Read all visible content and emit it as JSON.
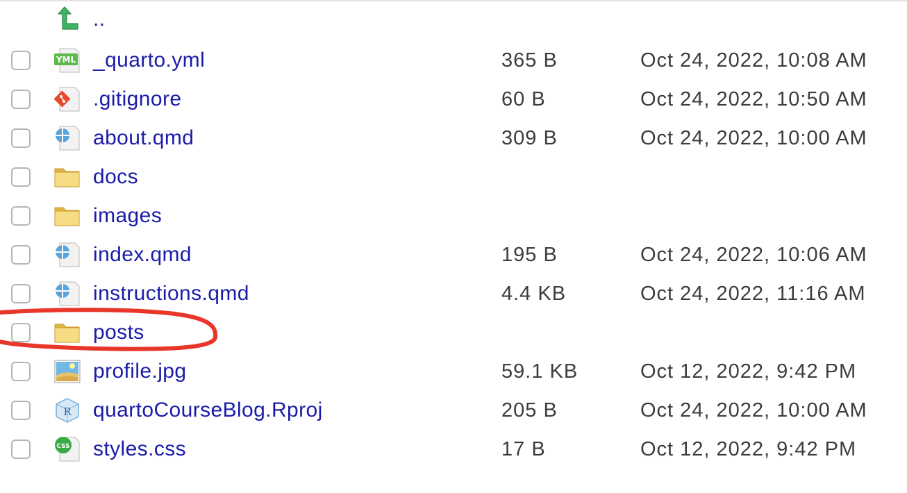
{
  "parent": {
    "label": "..",
    "icon": "up-arrow-icon"
  },
  "files": [
    {
      "name": "_quarto.yml",
      "size": "365 B",
      "modified": "Oct 24, 2022, 10:08 AM",
      "icon": "yml-file-icon"
    },
    {
      "name": ".gitignore",
      "size": "60 B",
      "modified": "Oct 24, 2022, 10:50 AM",
      "icon": "git-file-icon"
    },
    {
      "name": "about.qmd",
      "size": "309 B",
      "modified": "Oct 24, 2022, 10:00 AM",
      "icon": "quarto-file-icon"
    },
    {
      "name": "docs",
      "size": "",
      "modified": "",
      "icon": "folder-icon"
    },
    {
      "name": "images",
      "size": "",
      "modified": "",
      "icon": "folder-icon"
    },
    {
      "name": "index.qmd",
      "size": "195 B",
      "modified": "Oct 24, 2022, 10:06 AM",
      "icon": "quarto-file-icon"
    },
    {
      "name": "instructions.qmd",
      "size": "4.4 KB",
      "modified": "Oct 24, 2022, 11:16 AM",
      "icon": "quarto-file-icon"
    },
    {
      "name": "posts",
      "size": "",
      "modified": "",
      "icon": "folder-icon"
    },
    {
      "name": "profile.jpg",
      "size": "59.1 KB",
      "modified": "Oct 12, 2022, 9:42 PM",
      "icon": "image-file-icon"
    },
    {
      "name": "quartoCourseBlog.Rproj",
      "size": "205 B",
      "modified": "Oct 24, 2022, 10:00 AM",
      "icon": "rproj-file-icon"
    },
    {
      "name": "styles.css",
      "size": "17 B",
      "modified": "Oct 12, 2022, 9:42 PM",
      "icon": "css-file-icon"
    }
  ],
  "annotation": {
    "color": "#e8372a",
    "target": "posts"
  }
}
